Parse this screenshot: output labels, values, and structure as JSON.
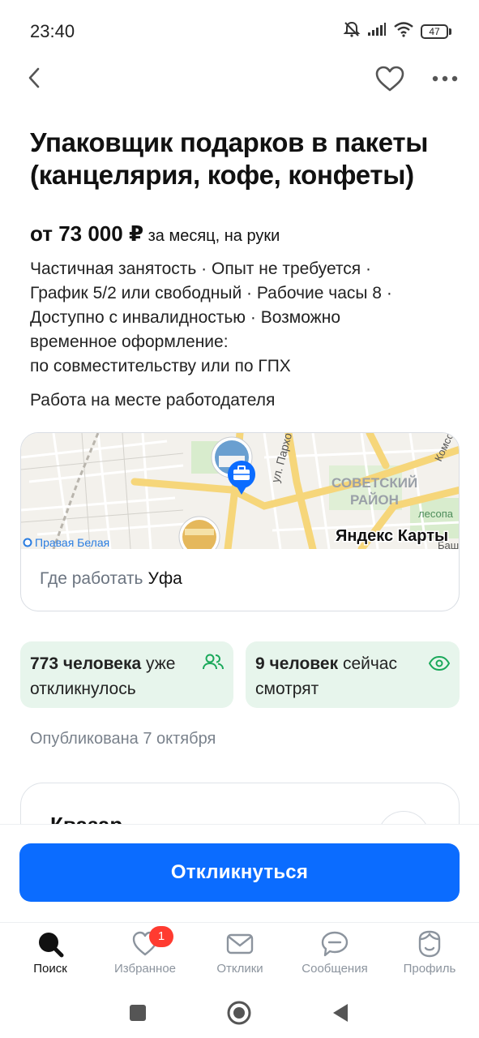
{
  "status_bar": {
    "time": "23:40",
    "battery": "47"
  },
  "job": {
    "title": "Упаковщик подарков в пакеты (канцелярия, кофе, конфеты)",
    "salary_amount": "от 73 000 ₽",
    "salary_period": "за месяц, на руки",
    "conditions": [
      "Частичная занятость · Опыт не требуется ·",
      "График 5/2 или свободный · Рабочие часы 8 ·",
      "Доступно с инвалидностью · Возможно",
      "временное оформление:",
      "по совместительству или по ГПХ"
    ],
    "work_place": "Работа на месте работодателя"
  },
  "map": {
    "street_label": "ул. Пархо",
    "district_label_1": "СОВЕТСКИЙ",
    "district_label_2": "РАЙОН",
    "corner_label_1": "Комсо",
    "corner_label_2": "лесопа",
    "corner_label_3": "Баш",
    "stop_label": "Правая Белая",
    "logo": "Яндекс Карты",
    "where_label": "Где работать",
    "city": "Уфа"
  },
  "stats": {
    "responded_count": "773 человека",
    "responded_text": "уже откликнулось",
    "watching_count": "9 человек",
    "watching_text": "сейчас смотрят"
  },
  "published": "Опубликована 7 октября",
  "employer": {
    "name_partial": "Квазар"
  },
  "apply_button": "Откликнуться",
  "tabs": [
    {
      "label": "Поиск",
      "icon": "search-icon",
      "active": true
    },
    {
      "label": "Избранное",
      "icon": "heart-icon",
      "badge": "1"
    },
    {
      "label": "Отклики",
      "icon": "envelope-icon"
    },
    {
      "label": "Сообщения",
      "icon": "chat-icon"
    },
    {
      "label": "Профиль",
      "icon": "profile-icon"
    }
  ],
  "colors": {
    "primary": "#0b6cff",
    "stat_bg": "#e7f5ec",
    "stat_icon": "#1aa85a",
    "badge": "#ff3b30"
  }
}
